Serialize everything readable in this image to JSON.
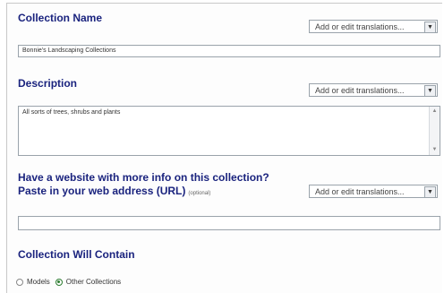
{
  "collection_name": {
    "label": "Collection Name",
    "translate_select": "Add or edit translations...",
    "value": "Bonnie's Landscaping Collections"
  },
  "description": {
    "label": "Description",
    "translate_select": "Add or edit translations...",
    "value": "All sorts of trees, shrubs and plants"
  },
  "website": {
    "question": "Have a website with more info on this collection?",
    "prompt": "Paste in your web address (URL)",
    "optional": "(optional)",
    "translate_select": "Add or edit translations...",
    "value": ""
  },
  "contain": {
    "label": "Collection Will Contain",
    "options": [
      "Models",
      "Other Collections"
    ],
    "selected": "Other Collections"
  },
  "icons": {
    "dropdown": "chevron-down-icon",
    "scroll_up": "scroll-up-icon",
    "scroll_down": "scroll-down-icon",
    "radio_selected": "#2e7d32"
  }
}
